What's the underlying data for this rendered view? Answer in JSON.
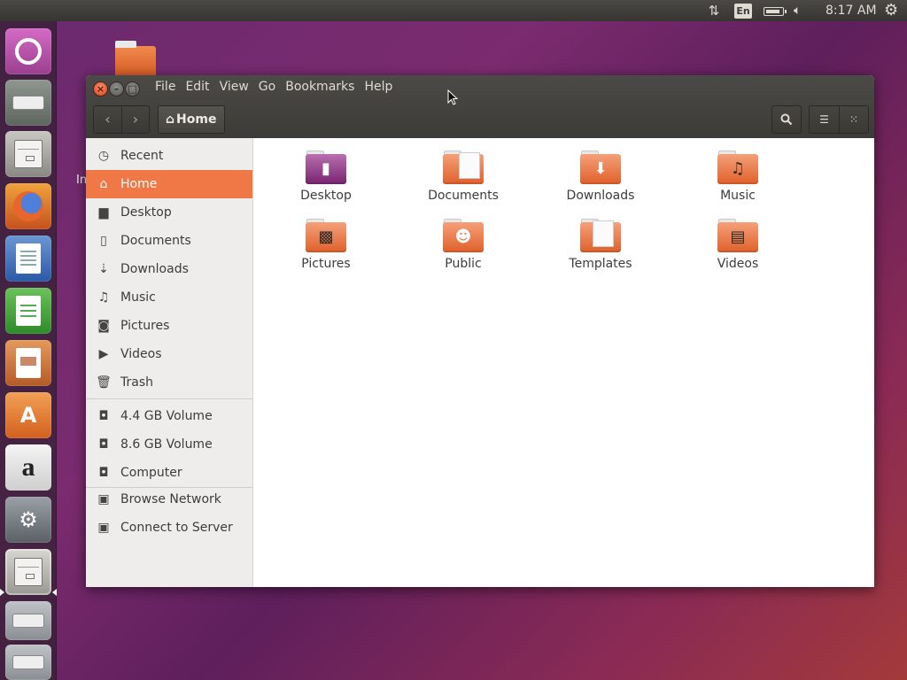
{
  "top_panel": {
    "keyboard_layout": "En",
    "clock": "8:17 AM"
  },
  "launcher": {
    "items": [
      {
        "name": "ubuntu-dash"
      },
      {
        "name": "install-ubuntu"
      },
      {
        "name": "files"
      },
      {
        "name": "firefox"
      },
      {
        "name": "libreoffice-writer"
      },
      {
        "name": "libreoffice-calc"
      },
      {
        "name": "libreoffice-impress"
      },
      {
        "name": "ubuntu-software"
      },
      {
        "name": "amazon"
      },
      {
        "name": "system-settings"
      },
      {
        "name": "files-running"
      },
      {
        "name": "drive"
      },
      {
        "name": "drive"
      }
    ],
    "amazon_glyph": "a"
  },
  "desktop": {
    "partial_label": "In"
  },
  "window": {
    "menu": [
      "File",
      "Edit",
      "Go",
      "View",
      "Bookmarks",
      "Help"
    ],
    "menu_order": [
      "File",
      "Edit",
      "View",
      "Go",
      "Bookmarks",
      "Help"
    ],
    "path_label": "Home",
    "sidebar": {
      "places": [
        "Recent",
        "Home",
        "Desktop",
        "Documents",
        "Downloads",
        "Music",
        "Pictures",
        "Videos",
        "Trash"
      ],
      "devices": [
        "4.4 GB Volume",
        "8.6 GB Volume",
        "Computer"
      ],
      "network": [
        "Browse Network",
        "Connect to Server"
      ],
      "active": "Home"
    },
    "folders": [
      "Desktop",
      "Documents",
      "Downloads",
      "Music",
      "Pictures",
      "Public",
      "Templates",
      "Videos"
    ]
  },
  "colors": {
    "accent": "#f07746",
    "panel": "#3c3b37",
    "folder_orange": "#e0602a",
    "desktop_folder_purple": "#772470"
  }
}
